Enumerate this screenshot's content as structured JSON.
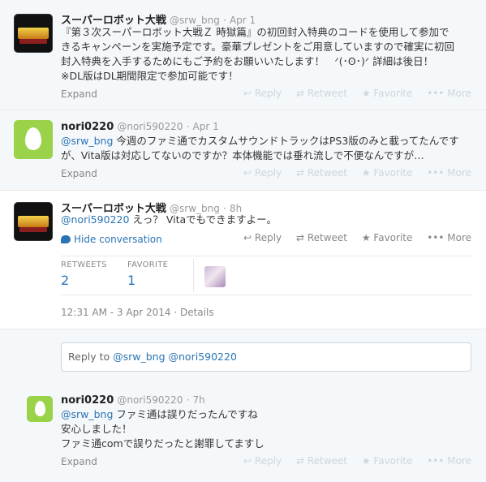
{
  "tweets": [
    {
      "name": "スーパーロボット大戦",
      "handle": "@srw_bng",
      "time": "Apr 1",
      "lines": [
        "『第３次スーパーロボット大戦Ｚ 時獄篇』の初回封入特典のコードを使用して参加で",
        "きるキャンペーンを実施予定です。豪華プレゼントをご用意していますので確実に初回",
        "封入特典を入手するためにもご予約をお願いいたします！　ᐟ(･ʘ･)ᐟ 詳細は後日！",
        "※DL版はDL期間限定で参加可能です！"
      ],
      "expand": "Expand"
    },
    {
      "name": "nori0220",
      "handle": "@nori590220",
      "time": "Apr 1",
      "mention": "@srw_bng",
      "line1_rest": " 今週のファミ通でカスタムサウンドトラックはPS3版のみと載ってたんです",
      "line2": "が、Vita版は対応してないのですか？本体機能では垂れ流しで不便なんですが…",
      "expand": "Expand"
    },
    {
      "name": "スーパーロボット大戦",
      "handle": "@srw_bng",
      "time": "8h",
      "mention": "@nori590220",
      "text_rest": " えっ？ Vitaでもできますよー。",
      "hide": "Hide conversation",
      "retweets_label": "RETWEETS",
      "retweets": "2",
      "favorite_label": "FAVORITE",
      "favorites": "1",
      "datetime": "12:31 AM - 3 Apr 2014",
      "details": "Details",
      "reply_prefix": "Reply to ",
      "reply_handles": "@srw_bng @nori590220"
    },
    {
      "name": "nori0220",
      "handle": "@nori590220",
      "time": "7h",
      "mention": "@srw_bng",
      "line1_rest": " ファミ通は誤りだったんですね",
      "line2": "安心しました！",
      "line3": "ファミ通comで誤りだったと謝罪してますし",
      "expand": "Expand"
    }
  ],
  "actions": {
    "reply": "↩ Reply",
    "retweet": "⇄ Retweet",
    "favorite": "★ Favorite",
    "more": "••• More"
  },
  "dot": "·"
}
